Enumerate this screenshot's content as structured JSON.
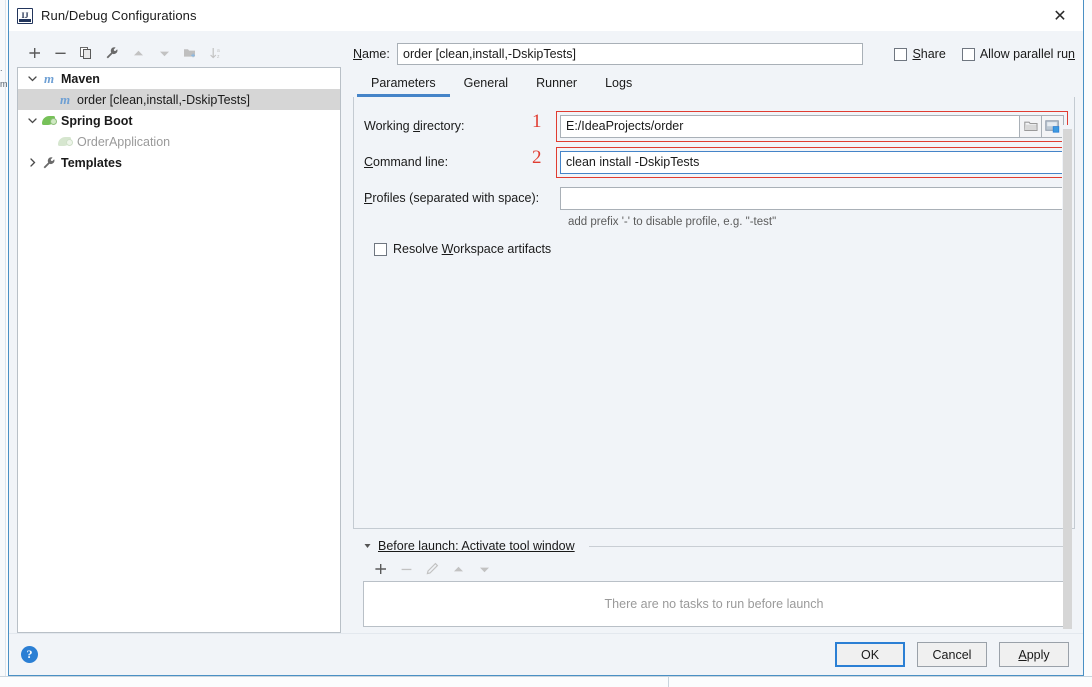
{
  "window": {
    "title": "Run/Debug Configurations",
    "app_icon": "intellij-idea-icon",
    "close_label": "✕"
  },
  "left_toolbar": {
    "buttons": [
      {
        "name": "add-configuration-button",
        "icon": "plus-icon",
        "glyph": "+",
        "enabled": true
      },
      {
        "name": "remove-configuration-button",
        "icon": "minus-icon",
        "glyph": "−",
        "enabled": true
      },
      {
        "name": "copy-configuration-button",
        "icon": "copy-icon",
        "glyph": "❐",
        "enabled": true
      },
      {
        "name": "edit-templates-button",
        "icon": "wrench-icon",
        "glyph": "🔧",
        "enabled": true
      },
      {
        "name": "move-up-button",
        "icon": "arrow-up-icon",
        "glyph": "▲",
        "enabled": false
      },
      {
        "name": "move-down-button",
        "icon": "arrow-down-icon",
        "glyph": "▼",
        "enabled": false
      },
      {
        "name": "move-into-folder-button",
        "icon": "new-folder-icon",
        "glyph": "▰",
        "enabled": false
      },
      {
        "name": "sort-configurations-button",
        "icon": "sort-alphabetically-icon",
        "glyph": "↓",
        "enabled": false
      }
    ]
  },
  "tree": {
    "nodes": [
      {
        "name": "tree-node-maven",
        "label": "Maven",
        "icon": "maven-icon",
        "indent": 0,
        "arrow": "expanded",
        "bold": true,
        "selected": false,
        "muted": false
      },
      {
        "name": "tree-node-order-config",
        "label": "order [clean,install,-DskipTests]",
        "prefix": "m",
        "icon": "maven-icon",
        "indent": 1,
        "arrow": "none",
        "bold": false,
        "selected": true,
        "muted": false
      },
      {
        "name": "tree-node-spring-boot",
        "label": "Spring Boot",
        "icon": "spring-icon",
        "indent": 0,
        "arrow": "expanded",
        "bold": true,
        "selected": false,
        "muted": false
      },
      {
        "name": "tree-node-order-application",
        "label": "OrderApplication",
        "icon": "spring-icon",
        "indent": 1,
        "arrow": "none",
        "bold": false,
        "selected": false,
        "muted": true
      },
      {
        "name": "tree-node-templates",
        "label": "Templates",
        "icon": "wrench-icon",
        "indent": 0,
        "arrow": "collapsed",
        "bold": true,
        "selected": false,
        "muted": false
      }
    ]
  },
  "name_row": {
    "label": "Name:",
    "label_mnemonic": "N",
    "value": "order [clean,install,-DskipTests]",
    "placeholder": "",
    "share_label": "Share",
    "share_mnemonic": "S",
    "share_checked": false,
    "parallel_label": "Allow parallel run",
    "parallel_mnemonic": "n",
    "parallel_checked": false
  },
  "tabs": {
    "items": [
      {
        "name": "tab-parameters",
        "label": "Parameters",
        "active": true
      },
      {
        "name": "tab-general",
        "label": "General",
        "active": false
      },
      {
        "name": "tab-runner",
        "label": "Runner",
        "active": false
      },
      {
        "name": "tab-logs",
        "label": "Logs",
        "active": false
      }
    ]
  },
  "parameters": {
    "working_directory": {
      "label": "Working directory:",
      "value": "E:/IdeaProjects/order",
      "placeholder": "",
      "annotation": "1",
      "browse_icon": "folder-icon",
      "macro_icon": "insert-macro-icon"
    },
    "command_line": {
      "label": "Command line:",
      "value": "clean install -DskipTests",
      "placeholder": "",
      "annotation": "2"
    },
    "profiles": {
      "label": "Profiles (separated with space):",
      "value": "",
      "placeholder": "",
      "hint": "add prefix '-' to disable profile, e.g. \"-test\""
    },
    "resolve_workspace": {
      "label": "Resolve Workspace artifacts",
      "mnemonic": "W",
      "checked": false
    }
  },
  "before_launch": {
    "header": "Before launch: Activate tool window",
    "empty_text": "There are no tasks to run before launch",
    "toolbar": [
      {
        "name": "bl-add-task-button",
        "icon": "plus-icon",
        "glyph": "+",
        "enabled": true
      },
      {
        "name": "bl-remove-task-button",
        "icon": "minus-icon",
        "glyph": "−",
        "enabled": false
      },
      {
        "name": "bl-edit-task-button",
        "icon": "pencil-icon",
        "glyph": "✎",
        "enabled": false
      },
      {
        "name": "bl-move-up-button",
        "icon": "arrow-up-icon",
        "glyph": "▲",
        "enabled": false
      },
      {
        "name": "bl-move-down-button",
        "icon": "arrow-down-icon",
        "glyph": "▼",
        "enabled": false
      }
    ]
  },
  "footer": {
    "help_icon": "help-icon",
    "help_glyph": "?",
    "ok_label": "OK",
    "cancel_label": "Cancel",
    "apply_label": "Apply",
    "apply_mnemonic": "A"
  },
  "colors": {
    "accent_blue": "#4584c8",
    "annotation_red": "#e03c31",
    "dialog_border": "#4a90c4",
    "selection_gray": "#d6d6d6",
    "maven_icon_blue": "#6d9fd4",
    "spring_green": "#77c159",
    "help_blue": "#2b7fd4"
  }
}
